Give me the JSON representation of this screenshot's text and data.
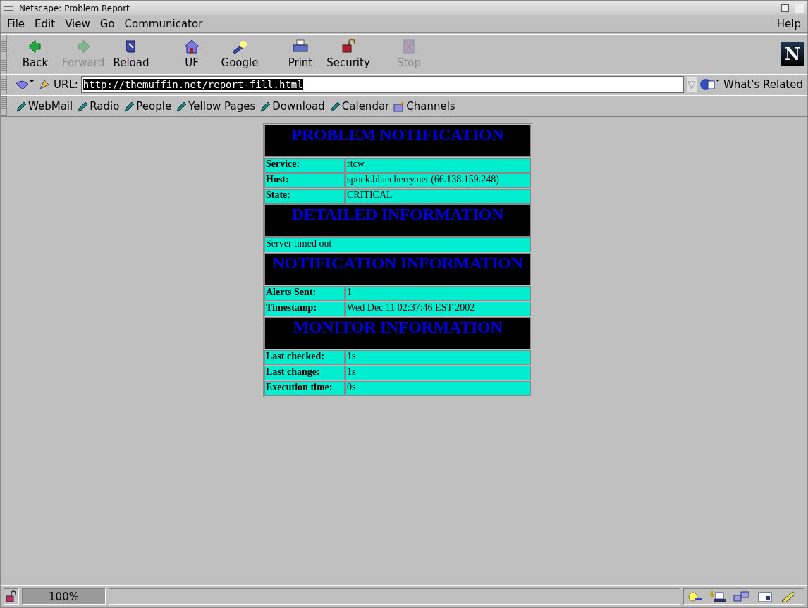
{
  "window": {
    "title": "Netscape: Problem Report"
  },
  "menu": [
    "File",
    "Edit",
    "View",
    "Go",
    "Communicator"
  ],
  "help_menu": "Help",
  "logo": "N",
  "toolbar": [
    {
      "label": "Back",
      "kind": "back",
      "disabled": false
    },
    {
      "label": "Forward",
      "kind": "forward",
      "disabled": true
    },
    {
      "label": "Reload",
      "kind": "reload",
      "disabled": false
    },
    {
      "label": "UF",
      "kind": "home",
      "disabled": false
    },
    {
      "label": "Google",
      "kind": "search",
      "disabled": false
    },
    {
      "label": "Print",
      "kind": "print",
      "disabled": false
    },
    {
      "label": "Security",
      "kind": "lock",
      "disabled": false
    },
    {
      "label": "Stop",
      "kind": "stop",
      "disabled": true
    }
  ],
  "location": {
    "label": "URL:",
    "value": "http://themuffin.net/report-fill.html",
    "related": "What's Related"
  },
  "personal_toolbar": [
    {
      "label": "WebMail",
      "kind": "bookmark"
    },
    {
      "label": "Radio",
      "kind": "bookmark"
    },
    {
      "label": "People",
      "kind": "bookmark"
    },
    {
      "label": "Yellow Pages",
      "kind": "bookmark"
    },
    {
      "label": "Download",
      "kind": "bookmark"
    },
    {
      "label": "Calendar",
      "kind": "bookmark"
    },
    {
      "label": "Channels",
      "kind": "folder"
    }
  ],
  "report": [
    {
      "heading": "PROBLEM NOTIFICATION",
      "rows": [
        {
          "kind": "pair",
          "label": "Service:",
          "value": "rtcw"
        },
        {
          "kind": "pair",
          "label": "Host:",
          "value": "spock.bluecherry.net (66.138.159.248)"
        },
        {
          "kind": "pair",
          "label": "State:",
          "value": "CRITICAL"
        }
      ]
    },
    {
      "heading": "DETAILED INFORMATION",
      "rows": [
        {
          "kind": "text",
          "value": "Server timed out"
        }
      ]
    },
    {
      "heading": "NOTIFICATION INFORMATION",
      "rows": [
        {
          "kind": "pair",
          "label": "Alerts Sent:",
          "value": "1"
        },
        {
          "kind": "pair",
          "label": "Timestamp:",
          "value": "Wed Dec 11 02:37:46 EST 2002"
        }
      ]
    },
    {
      "heading": "MONITOR INFORMATION",
      "rows": [
        {
          "kind": "pair",
          "label": "Last checked:",
          "value": "1s"
        },
        {
          "kind": "pair",
          "label": "Last change:",
          "value": "1s"
        },
        {
          "kind": "pair",
          "label": "Execution time:",
          "value": "0s"
        }
      ]
    }
  ],
  "status_bar": {
    "zoom": "100%"
  }
}
